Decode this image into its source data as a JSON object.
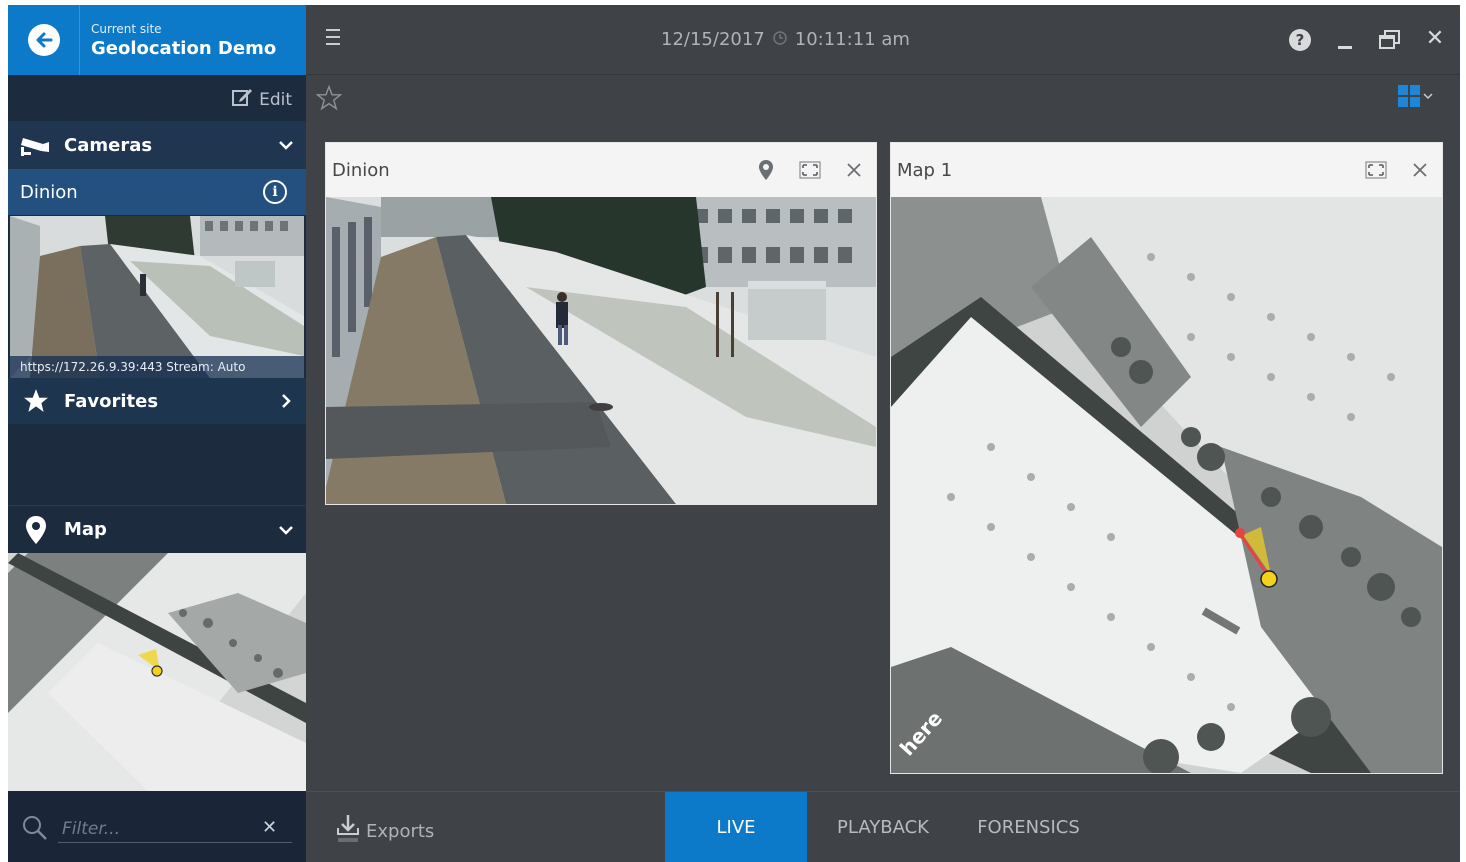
{
  "site": {
    "label": "Current site",
    "name": "Geolocation Demo"
  },
  "sidebar": {
    "edit_label": "Edit",
    "cameras_label": "Cameras",
    "camera_item": "Dinion",
    "camera_caption": "https://172.26.9.39:443 Stream: Auto",
    "favorites_label": "Favorites",
    "map_label": "Map",
    "filter_placeholder": "Filter..."
  },
  "topbar": {
    "date": "12/15/2017",
    "time": "10:11:11 am",
    "help": "?"
  },
  "panels": {
    "camera_title": "Dinion",
    "map_title": "Map 1",
    "map_watermark": "here"
  },
  "bottombar": {
    "exports_label": "Exports",
    "tabs": [
      "LIVE",
      "PLAYBACK",
      "FORENSICS"
    ],
    "active_tab": "LIVE"
  },
  "colors": {
    "accent": "#0c79c9",
    "sidebar_bg": "#1c2b3e",
    "workspace_bg": "#3f4247",
    "selected_camera_bg": "#23507e",
    "camera_marker": "#f2d21b",
    "pan_marker": "#e8433f"
  },
  "icons": {
    "back": "arrow-left-circle-icon",
    "edit": "edit-icon",
    "cameras": "cctv-icon",
    "favorites": "star-icon",
    "map": "map-pin-icon",
    "info": "info-icon",
    "search": "search-icon",
    "menu": "hamburger-icon",
    "clock": "clock-icon",
    "layout": "grid-layout-icon",
    "exports": "download-icon"
  }
}
